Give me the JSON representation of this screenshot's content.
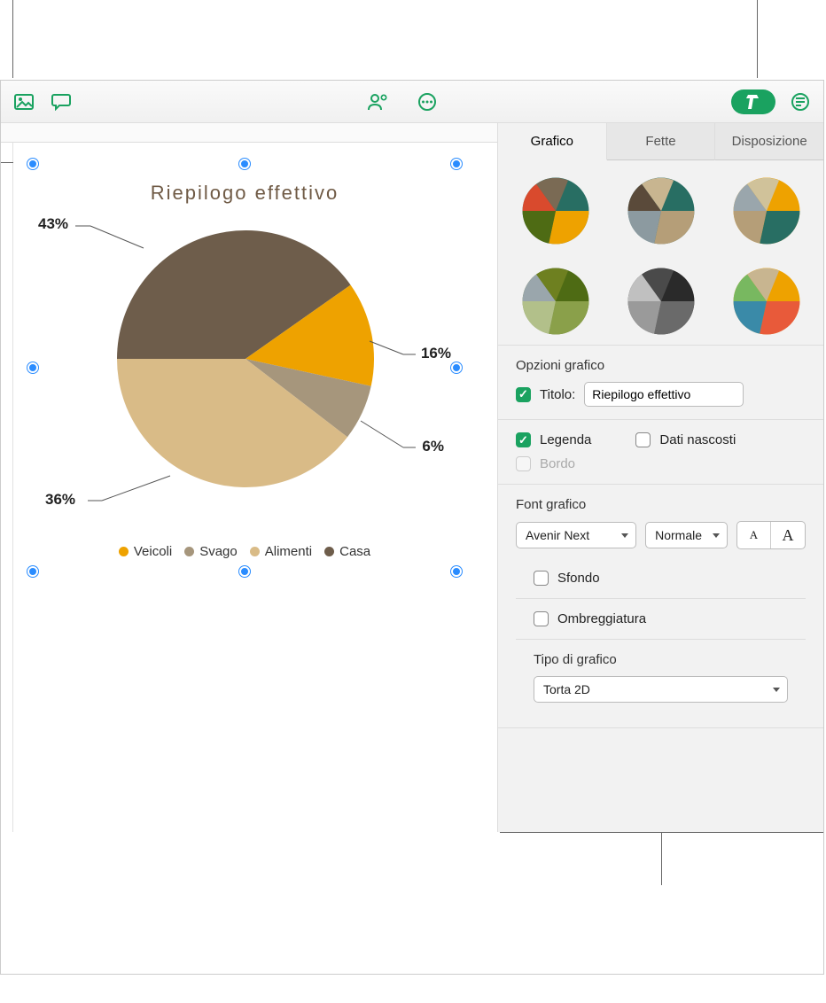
{
  "toolbar": {
    "icons": [
      "image-icon",
      "comment-icon",
      "collaborate-icon",
      "more-icon",
      "format-icon",
      "document-icon"
    ]
  },
  "chart_data": {
    "type": "pie",
    "title": "Riepilogo effettivo",
    "series": [
      {
        "name": "Casa",
        "value": 43,
        "label": "43%",
        "color": "#6e5d4b"
      },
      {
        "name": "Alimenti",
        "value": 36,
        "label": "36%",
        "color": "#d9bb87"
      },
      {
        "name": "Svago",
        "value": 6,
        "label": "6%",
        "color": "#a6967c"
      },
      {
        "name": "Veicoli",
        "value": 16,
        "label": "16%",
        "color": "#eea200"
      }
    ],
    "legend_order": [
      "Veicoli",
      "Svago",
      "Alimenti",
      "Casa"
    ]
  },
  "chart": {
    "title": "Riepilogo effettivo",
    "labels": {
      "l43": "43%",
      "l36": "36%",
      "l6": "6%",
      "l16": "16%"
    },
    "legend": {
      "veicoli": "Veicoli",
      "svago": "Svago",
      "alimenti": "Alimenti",
      "casa": "Casa"
    },
    "colors": {
      "casa": "#6e5d4b",
      "alimenti": "#d9bb87",
      "svago": "#a6967c",
      "veicoli": "#eea200"
    }
  },
  "inspector": {
    "tabs": {
      "grafico": "Grafico",
      "fette": "Fette",
      "disposizione": "Disposizione"
    },
    "options_title": "Opzioni grafico",
    "titolo_label": "Titolo:",
    "titolo_value": "Riepilogo effettivo",
    "legenda": "Legenda",
    "dati_nascosti": "Dati nascosti",
    "bordo": "Bordo",
    "font_title": "Font grafico",
    "font_family": "Avenir Next",
    "font_style": "Normale",
    "sfondo": "Sfondo",
    "ombreggiatura": "Ombreggiatura",
    "tipo_title": "Tipo di grafico",
    "tipo_value": "Torta 2D"
  }
}
